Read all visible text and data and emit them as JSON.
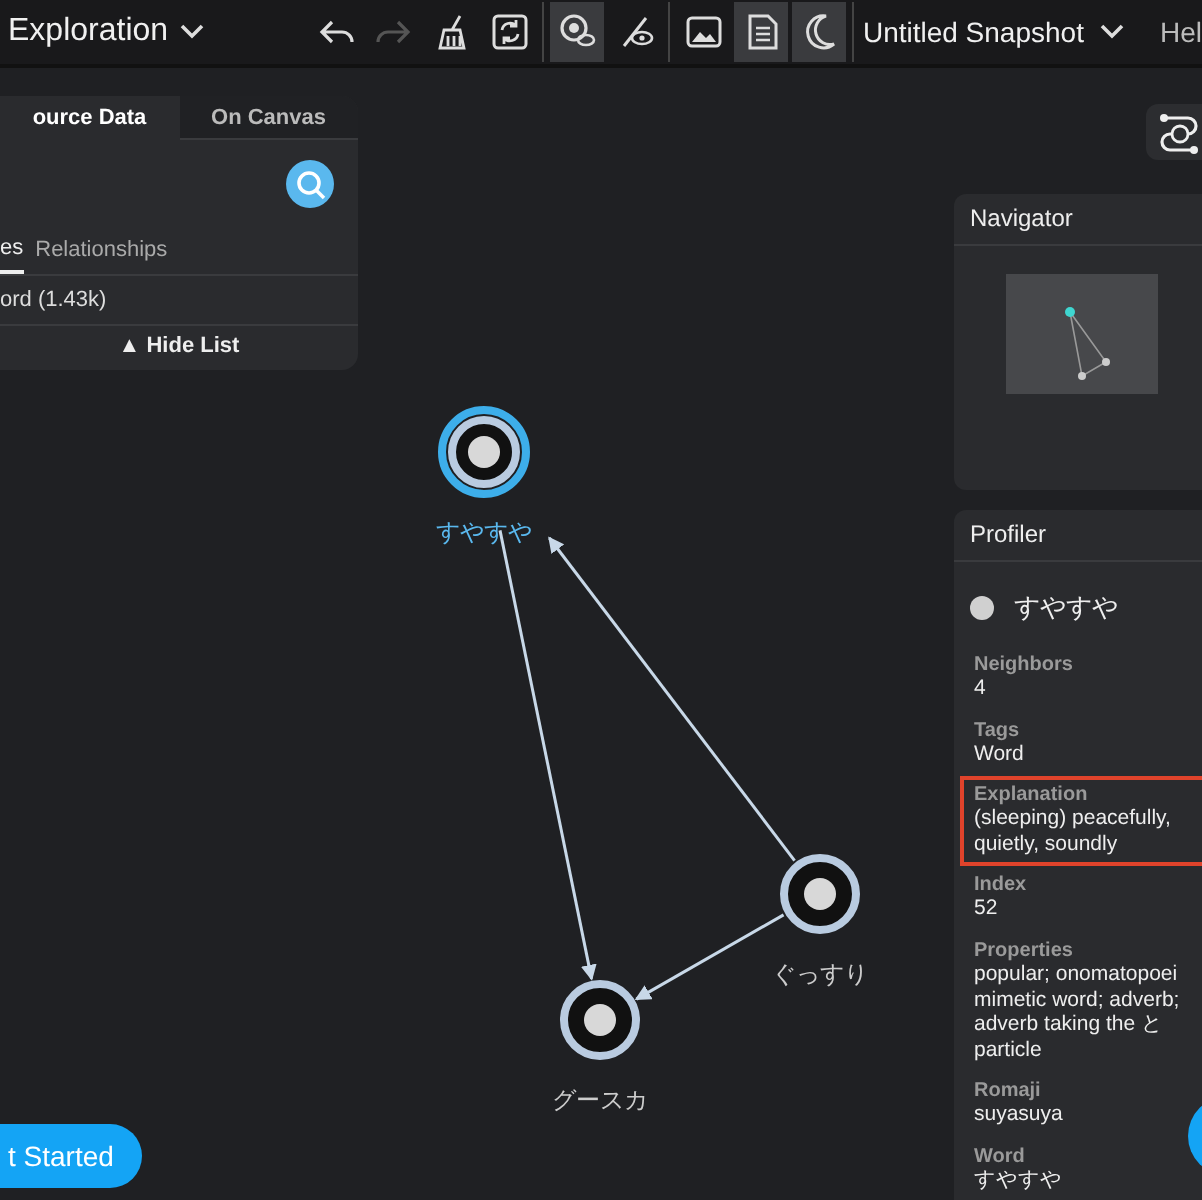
{
  "topbar": {
    "view": "Exploration",
    "tool_groups": [
      [
        {
          "kind": "undo",
          "selected": false,
          "disabled": false
        },
        {
          "kind": "redo",
          "selected": false,
          "disabled": true
        },
        {
          "kind": "broom",
          "selected": false,
          "disabled": false
        },
        {
          "kind": "refresh",
          "selected": false,
          "disabled": false
        }
      ],
      [
        {
          "kind": "eye-node",
          "selected": true,
          "disabled": false
        },
        {
          "kind": "eye-off",
          "selected": false,
          "disabled": false
        }
      ],
      [
        {
          "kind": "image",
          "selected": false,
          "disabled": false
        },
        {
          "kind": "document",
          "selected": true,
          "disabled": false
        },
        {
          "kind": "moon",
          "selected": true,
          "disabled": false
        }
      ]
    ],
    "snapshot": "Untitled Snapshot",
    "help": "Hel"
  },
  "left_panel": {
    "tabs": [
      {
        "label": "ource Data",
        "selected": true
      },
      {
        "label": "On Canvas",
        "selected": false
      }
    ],
    "subtabs": [
      {
        "label": "es",
        "selected": true
      },
      {
        "label": "Relationships",
        "selected": false
      }
    ],
    "rows": [
      "ord (1.43k)"
    ],
    "hide_button": "▲ Hide List"
  },
  "graph": {
    "nodes": [
      {
        "label": "すやすや",
        "selected": true
      },
      {
        "label": "ぐっすり",
        "selected": false
      },
      {
        "label": "グースカ",
        "selected": false
      }
    ]
  },
  "navigator": {
    "title": "Navigator"
  },
  "profiler": {
    "title": "Profiler",
    "node": "すやすや",
    "fields": [
      {
        "label": "Neighbors",
        "value": "4",
        "highlighted": false
      },
      {
        "label": "Tags",
        "value": "Word",
        "highlighted": false
      },
      {
        "label": "Explanation",
        "value": "(sleeping) peacefully,\nquietly, soundly",
        "highlighted": true
      },
      {
        "label": "Index",
        "value": "52",
        "highlighted": false
      },
      {
        "label": "Properties",
        "value": "popular; onomatopoei\nmimetic word; adverb;\nadverb taking the と\nparticle",
        "highlighted": false
      },
      {
        "label": "Romaji",
        "value": "suyasuya",
        "highlighted": false
      },
      {
        "label": "Word",
        "value": "すやすや",
        "highlighted": false
      }
    ]
  },
  "get_started": "t Started"
}
